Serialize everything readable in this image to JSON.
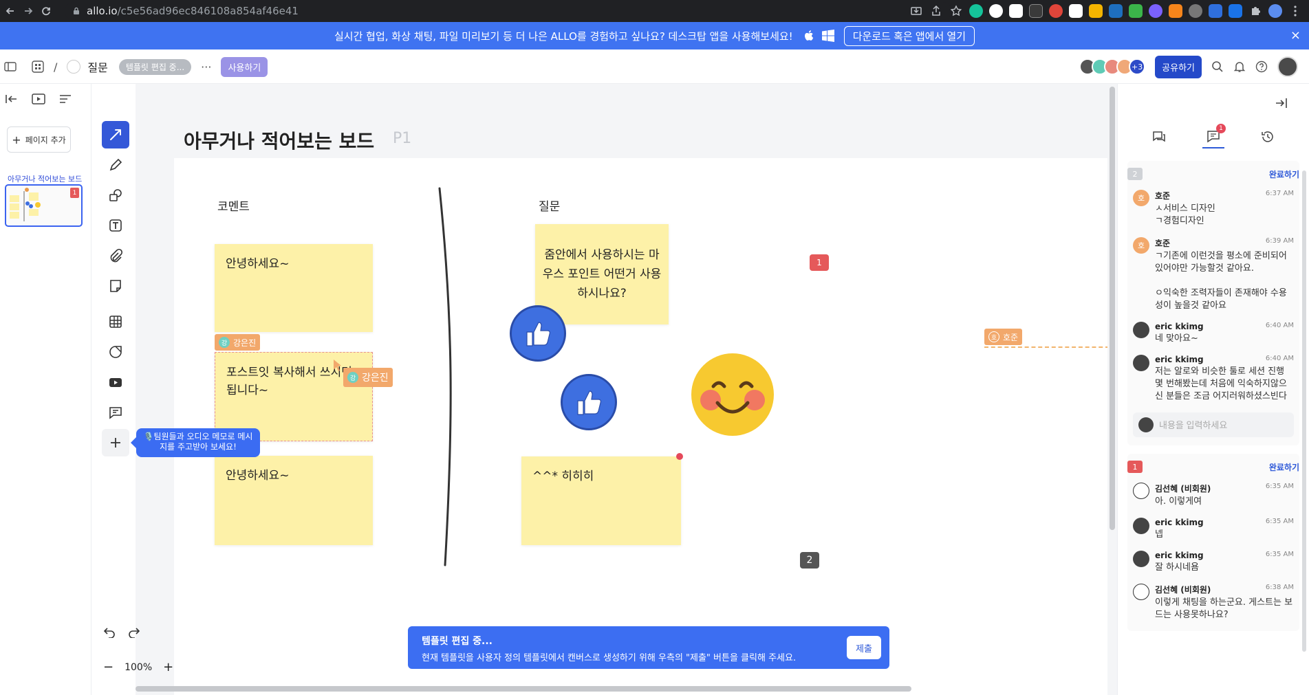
{
  "browser": {
    "url_host": "allo.io",
    "url_path": "/c5e56ad96ec846108a854af46e41"
  },
  "banner": {
    "text": "실시간 협업, 화상 채팅, 파일 미리보기 등 더 나은 ALLO를 경험하고 싶나요? 데스크탑 앱을 사용해보세요!",
    "button": "다운로드 혹은 앱에서 열기",
    "close": "×"
  },
  "header": {
    "separator": "/",
    "title": "질문",
    "template_pill": "템플릿 편집 중...",
    "more": "···",
    "use_button": "사용하기",
    "avatar_more": "+3",
    "share_button": "공유하기"
  },
  "pages": {
    "add_page": "페이지 추가",
    "page_label": "아무거나 적어보는 보드",
    "thumb_badge": "1"
  },
  "tooltip": {
    "audio": "🎙️팀원들과 오디오 메모로 메시지를 주고받아 보세요!"
  },
  "zoom": {
    "minus": "−",
    "level": "100%",
    "plus": "+"
  },
  "board": {
    "title": "아무거나 적어보는 보드",
    "page": "P1",
    "sections": {
      "comment": "코멘트",
      "question": "질문"
    },
    "stickies": {
      "s1": "안녕하세요~",
      "s2": "포스트잇 복사해서 쓰시면 됩니다~",
      "s3": "안녕하세요~",
      "q1": "줌안에서 사용하시는 마우스 포인트 어떤거 사용하시나요?",
      "q2": "^^* 히히히"
    },
    "user_tags": {
      "tag1": "강은진",
      "tag2": "강은진",
      "tag3": "호준",
      "tag1_initial": "강",
      "tag2_initial": "강",
      "tag3_initial": "호"
    },
    "badges": {
      "red": "1",
      "dark": "2"
    }
  },
  "template_bar": {
    "title": "템플릿 편집 중...",
    "text": "현재 템플릿을 사용자 정의 템플릿에서 캔버스로 생성하기 위해 우측의 \"제출\" 버튼을 클릭해 주세요.",
    "submit": "제출"
  },
  "comments": {
    "tab_badge": "1",
    "threads": [
      {
        "num": "2",
        "done": "완료하기",
        "input_placeholder": "내용을 입력하세요",
        "messages": [
          {
            "name": "호준",
            "initial": "호",
            "time": "6:37 AM",
            "text": "ㅅ서비스 디자인\nㄱ경험디자인"
          },
          {
            "name": "호준",
            "initial": "호",
            "time": "6:39 AM",
            "text": "ㄱ기존에 이런것을 평소에 준비되어 있어야만  가능할것 같아요.\n\nㅇ익숙한 조력자들이 존재해야 수용성이 높을것 같아요"
          },
          {
            "name": "eric kkimg",
            "initial": "",
            "time": "6:40 AM",
            "text": "네 맞아요~"
          },
          {
            "name": "eric kkimg",
            "initial": "",
            "time": "6:40 AM",
            "text": "저는 알로와 비슷한 툴로 세션 진행 몇 번해봤는데 처음에 익숙하지않으신 분들은 조금 어지러워하셨스빈다"
          }
        ]
      },
      {
        "num": "1",
        "done": "완료하기",
        "messages": [
          {
            "name": "김선혜 (비회원)",
            "initial": "",
            "time": "6:35 AM",
            "text": "아. 이렇게여"
          },
          {
            "name": "eric kkimg",
            "initial": "",
            "time": "6:35 AM",
            "text": "넵"
          },
          {
            "name": "eric kkimg",
            "initial": "",
            "time": "6:35 AM",
            "text": "잘 하시네욤"
          },
          {
            "name": "김선혜 (비회원)",
            "initial": "",
            "time": "6:38 AM",
            "text": "이렇게 채팅을 하는군요. 게스트는 보드는 사용못하나요?"
          }
        ]
      }
    ]
  },
  "colors": {
    "accent": "#3f73f1",
    "sticky": "#fdf1a8",
    "badge_red": "#e5595a",
    "share": "#2449c9"
  }
}
